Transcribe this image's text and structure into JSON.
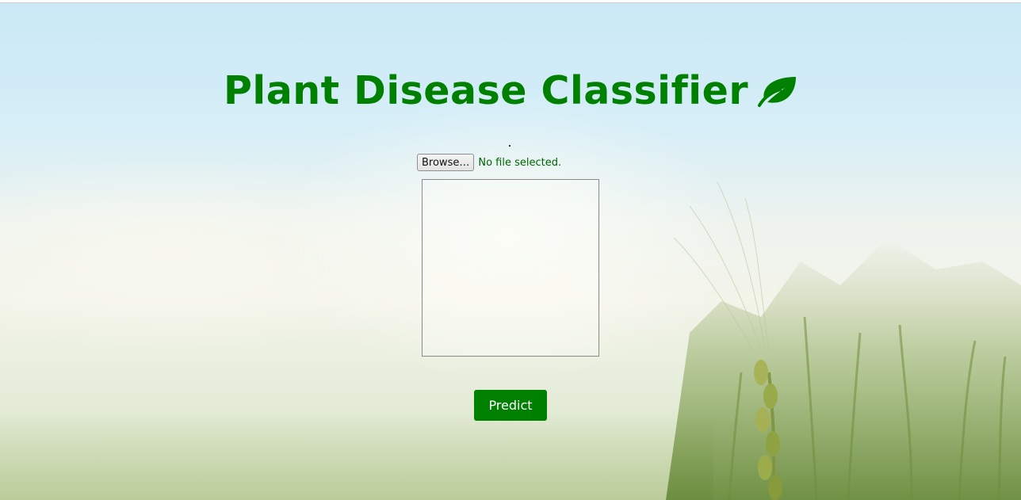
{
  "header": {
    "title": "Plant Disease Classifier",
    "title_icon": "leaf-icon"
  },
  "upload": {
    "browse_label": "Browse…",
    "status_text": "No file selected."
  },
  "actions": {
    "predict_label": "Predict"
  },
  "colors": {
    "accent": "#008000",
    "status_text": "#006400"
  }
}
